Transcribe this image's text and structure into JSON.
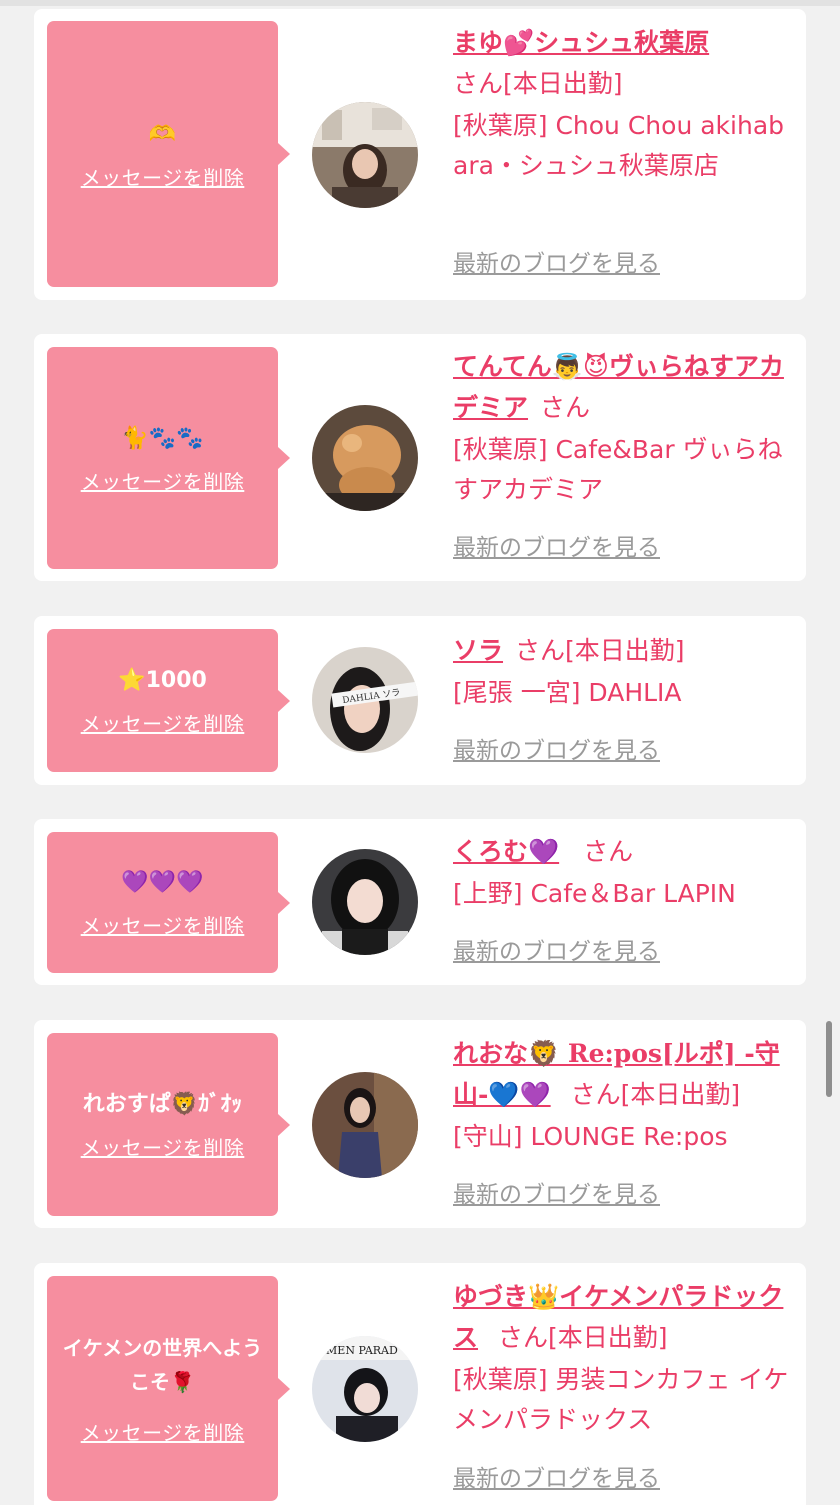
{
  "common": {
    "delete_label": "メッセージを削除",
    "blog_label": "最新のブログを見る",
    "san": "さん"
  },
  "entries": [
    {
      "message": "🫶",
      "name": "まゆ💕シュシュ秋葉原",
      "status": "[本日出勤]",
      "shop": "[秋葉原] Chou Chou akihabara・シュシュ秋葉原店"
    },
    {
      "message": "🐈🐾🐾",
      "name": "てんてん👼😈ヴぃらねすアカデミア",
      "status": "",
      "shop": "[秋葉原] Cafe&Bar ヴぃらねすアカデミア"
    },
    {
      "message": "⭐1000",
      "name": "ソラ",
      "status": "[本日出勤]",
      "shop": "[尾張 一宮] DAHLIA"
    },
    {
      "message": "💜💜💜",
      "name": "くろむ💜",
      "status": "",
      "shop": "[上野] Cafe＆Bar LAPIN"
    },
    {
      "message": "れおすぱ🦁ｶﾞｵｯ",
      "name": "れおな🦁 Re:pos[ルポ] -守山-💙💜",
      "status": "[本日出勤]",
      "shop": "[守山] LOUNGE Re:pos"
    },
    {
      "message": "イケメンの世界へようこそ🌹",
      "name": "ゆづき👑イケメンパラドックス",
      "status": "[本日出勤]",
      "shop": "[秋葉原] 男装コンカフェ イケメンパラドックス"
    }
  ],
  "colors": {
    "accent": "#ea3d67",
    "message_bg": "#f68e9f",
    "page_bg": "#f1f1f1",
    "link_gray": "#9a9a9a"
  }
}
